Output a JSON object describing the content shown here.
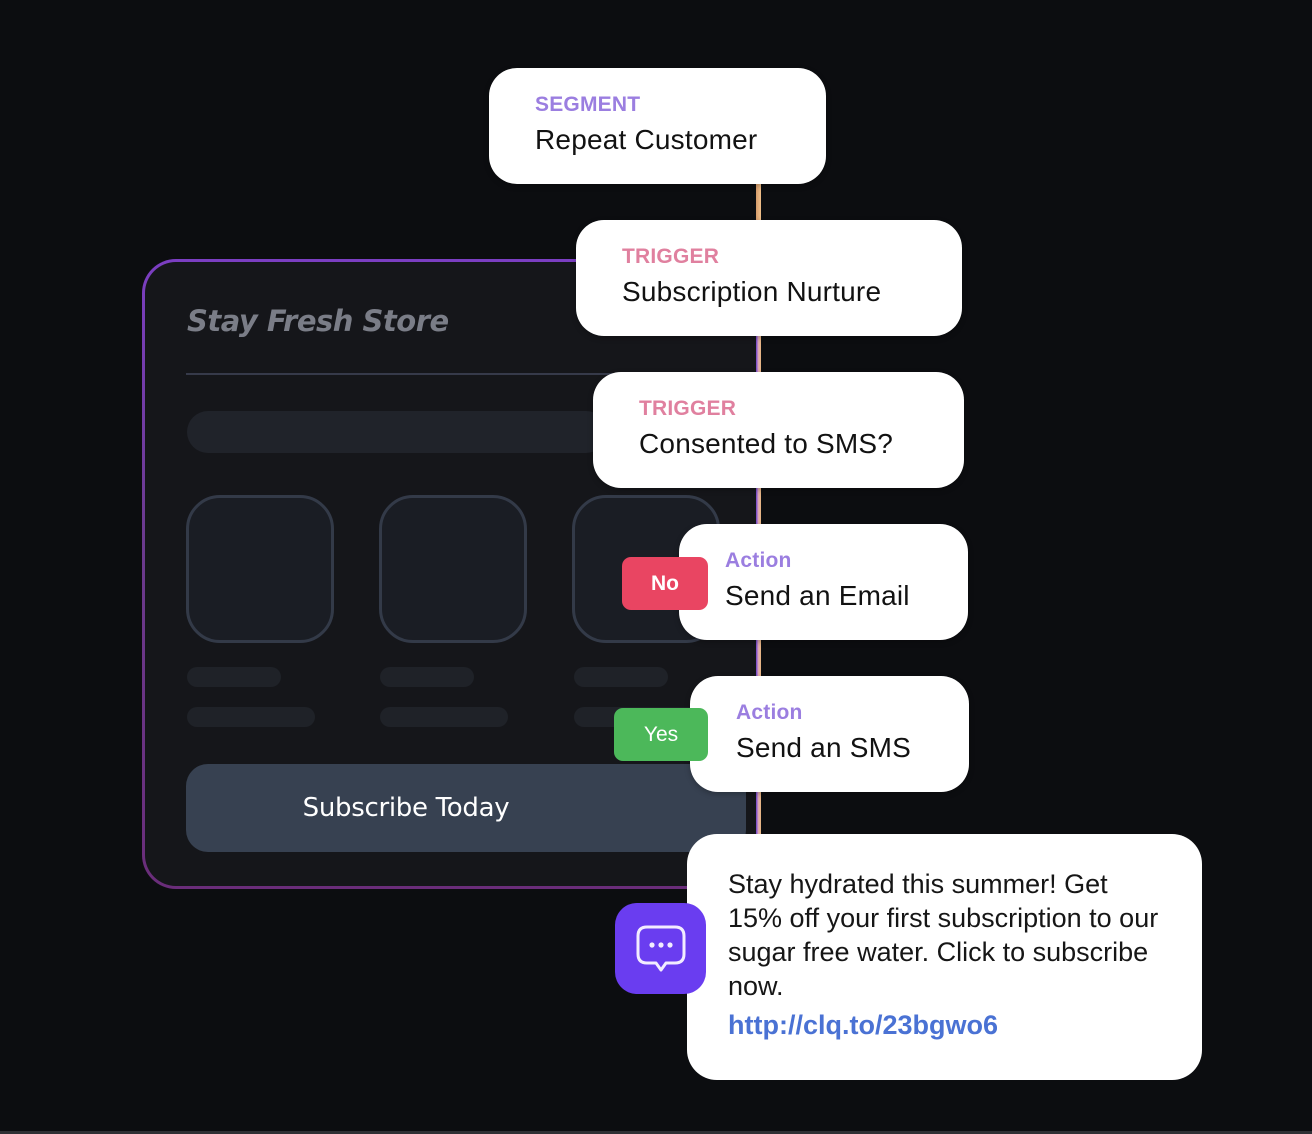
{
  "store": {
    "name": "Stay Fresh Store",
    "cta_label": "Subscribe Today",
    "product_count": 3
  },
  "flow": {
    "segment": {
      "label": "SEGMENT",
      "title": "Repeat Customer"
    },
    "trigger_1": {
      "label": "TRIGGER",
      "title": "Subscription Nurture"
    },
    "trigger_2": {
      "label": "TRIGGER",
      "title": "Consented to SMS?"
    },
    "action_no": {
      "badge": "No",
      "label": "Action",
      "title": "Send an Email"
    },
    "action_yes": {
      "badge": "Yes",
      "label": "Action",
      "title": "Send an SMS"
    }
  },
  "sms": {
    "icon": "chat-bubble-icon",
    "message": "Stay hydrated this summer! Get 15% off your first subscription to our sugar free water. Click to subscribe now.",
    "link": "http://clq.to/23bgwo6"
  },
  "colors": {
    "background": "#0c0d10",
    "segment_label": "#9b7ee0",
    "trigger_label": "#e0809f",
    "action_label": "#9b7ee0",
    "no_badge": "#e94562",
    "yes_badge": "#4cb85a",
    "chat_icon_bg": "#6a3df0",
    "link": "#4a72d4",
    "frame_accent": "#7b3ec2"
  }
}
